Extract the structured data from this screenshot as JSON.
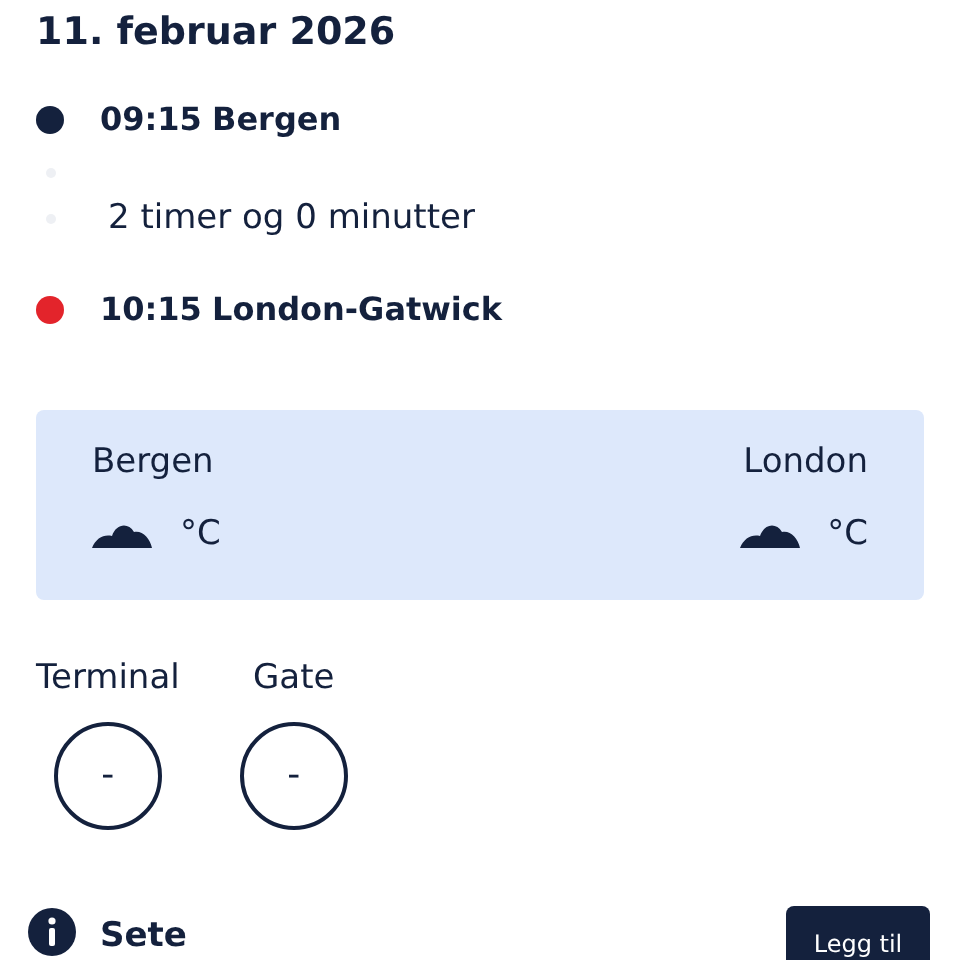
{
  "date": "11. februar 2026",
  "stops": [
    {
      "time": "09:15",
      "place": "Bergen",
      "color": "#14213d"
    },
    {
      "time": "10:15",
      "place": "London-Gatwick",
      "color": "#e3242b"
    }
  ],
  "duration": "2 timer og 0 minutter",
  "weather": [
    {
      "city": "Bergen",
      "unit": "°C"
    },
    {
      "city": "London",
      "unit": "°C"
    }
  ],
  "info": [
    {
      "label": "Terminal",
      "value": "-"
    },
    {
      "label": "Gate",
      "value": "-"
    }
  ],
  "seat": {
    "label": "Sete",
    "button": "Legg til"
  }
}
